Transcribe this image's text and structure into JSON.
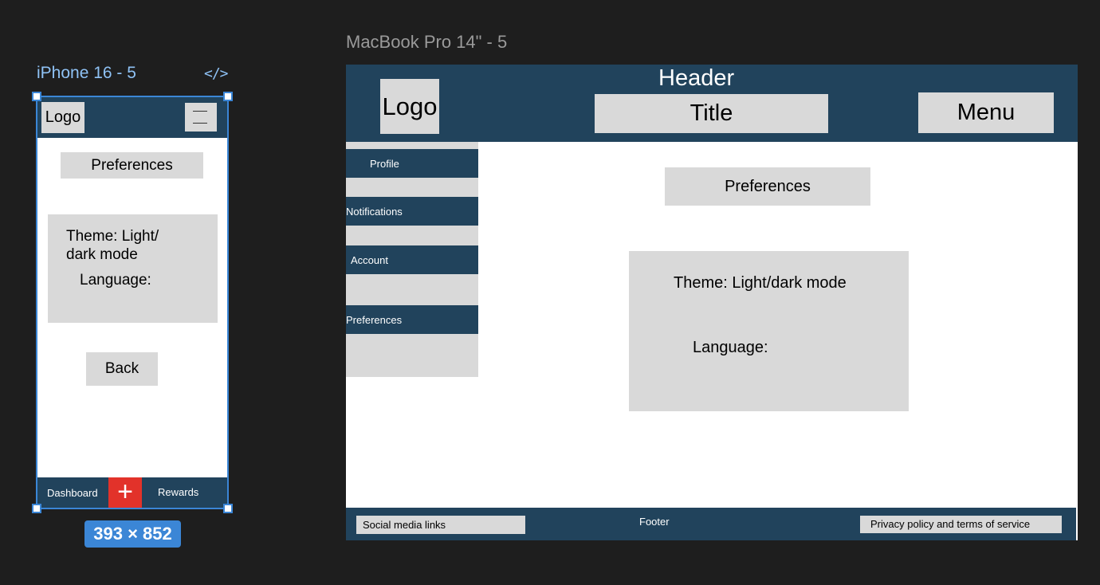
{
  "canvas": {
    "phone_frame_label": "iPhone 16 - 5",
    "desktop_frame_label": "MacBook Pro 14\" - 5",
    "phone_dimensions": "393 × 852",
    "code_icon_glyph": "</>"
  },
  "phone": {
    "logo": "Logo",
    "preferences": "Preferences",
    "theme": "Theme:  Light/\ndark mode",
    "language": "Language:",
    "back": "Back",
    "bottom_nav": {
      "dashboard": "Dashboard",
      "plus": "+",
      "rewards": "Rewards"
    }
  },
  "desktop": {
    "header_label": "Header",
    "logo": "Logo",
    "title": "Title",
    "menu": "Menu",
    "sidebar": [
      "Profile",
      "Notifications",
      "Account",
      "Preferences"
    ],
    "preferences": "Preferences",
    "theme": "Theme:  Light/dark mode",
    "language": "Language:",
    "footer": {
      "social": "Social media links",
      "label": "Footer",
      "privacy": "Privacy policy and terms of service"
    }
  },
  "colors": {
    "navy": "#21435c",
    "gray": "#d9d9d9",
    "selection_blue": "#3b86d6",
    "accent_red": "#e2322a",
    "canvas_bg": "#1e1e1e"
  }
}
